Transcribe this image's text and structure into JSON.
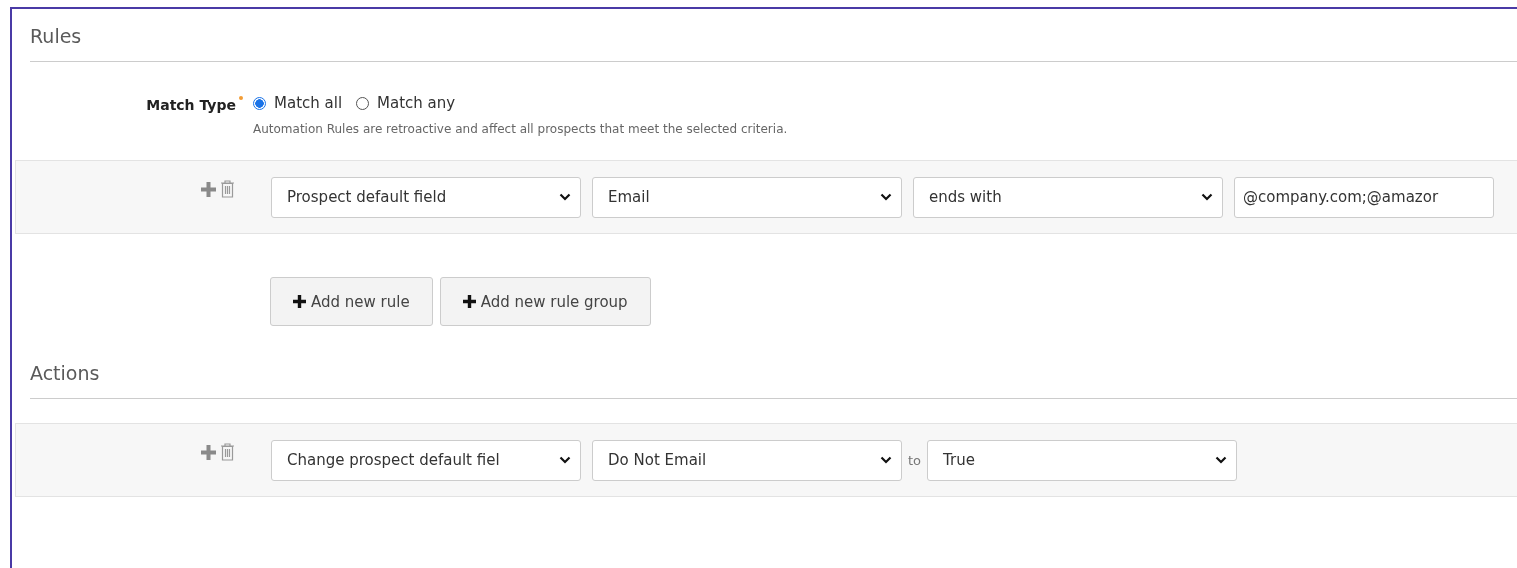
{
  "rules": {
    "heading": "Rules",
    "match_type": {
      "label": "Match Type",
      "required": true,
      "options": [
        {
          "label": "Match all",
          "selected": true
        },
        {
          "label": "Match any",
          "selected": false
        }
      ],
      "help": "Automation Rules are retroactive and affect all prospects that meet the selected criteria."
    },
    "rows": [
      {
        "controls": [
          {
            "kind": "select",
            "value": "Prospect default field"
          },
          {
            "kind": "select",
            "value": "Email"
          },
          {
            "kind": "select",
            "value": "ends with"
          },
          {
            "kind": "text",
            "value": "@company.com;@amazor"
          }
        ]
      }
    ],
    "buttons": [
      "Add new rule",
      "Add new rule group"
    ]
  },
  "actions": {
    "heading": "Actions",
    "rows": [
      {
        "controls": [
          {
            "kind": "select",
            "value": "Change prospect default fiel"
          },
          {
            "kind": "select",
            "value": "Do Not Email"
          },
          {
            "kind": "word",
            "value": "to"
          },
          {
            "kind": "select",
            "value": "True"
          }
        ]
      }
    ]
  }
}
